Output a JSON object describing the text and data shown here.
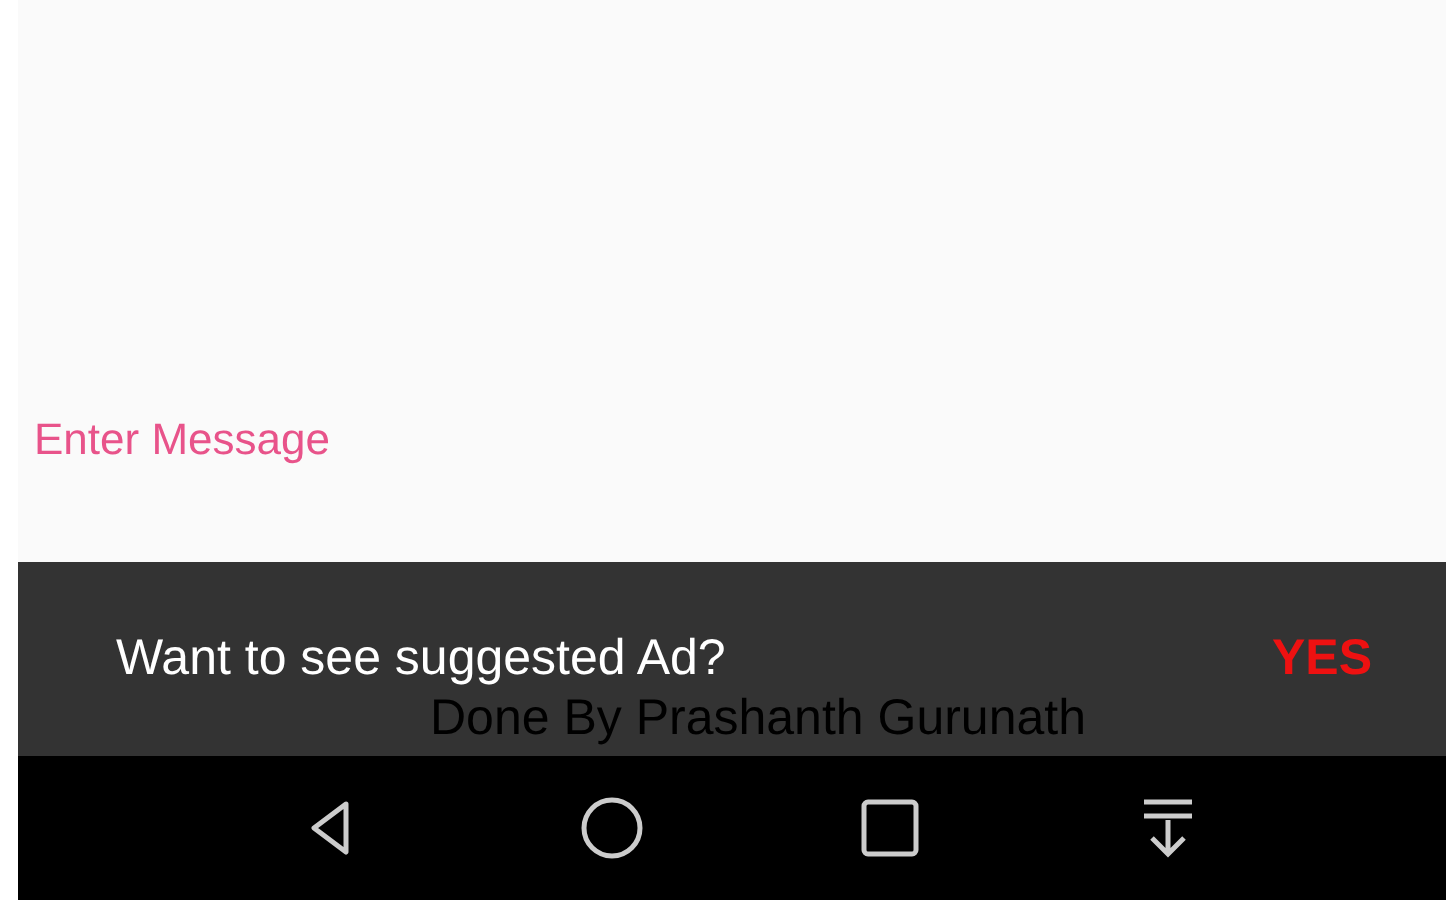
{
  "message_field": {
    "placeholder": "Enter Message"
  },
  "snackbar": {
    "message": "Want to see suggested Ad?",
    "action": "YES"
  },
  "footer": {
    "credit": "Done By Prashanth Gurunath"
  },
  "nav_bar": {
    "buttons": [
      {
        "kind": "back"
      },
      {
        "kind": "home"
      },
      {
        "kind": "recents"
      },
      {
        "kind": "notifications"
      }
    ]
  }
}
